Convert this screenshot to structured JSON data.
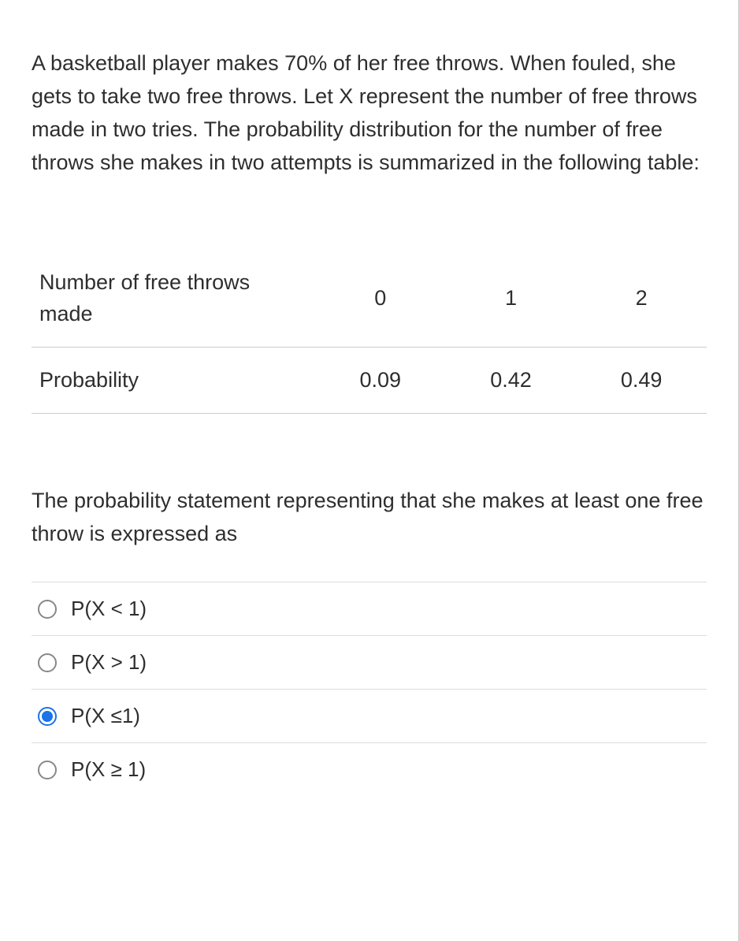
{
  "intro": "A basketball player makes 70% of her free throws.  When fouled, she gets to take two free throws. Let X represent the number of free throws made in two tries. The probability distribution for the number of free throws she makes in two attempts is summarized in the following table:",
  "table": {
    "row1_label": "Number of free throws made",
    "row2_label": "Probability",
    "col0_header": "0",
    "col1_header": "1",
    "col2_header": "2",
    "prob0": "0.09",
    "prob1": "0.42",
    "prob2": "0.49"
  },
  "question": "The probability statement representing that she makes at least one free throw is expressed as",
  "options": {
    "a": "P(X < 1)",
    "b": "P(X > 1)",
    "c": "P(X ≤1)",
    "d": "P(X ≥ 1)"
  },
  "selected": "c"
}
